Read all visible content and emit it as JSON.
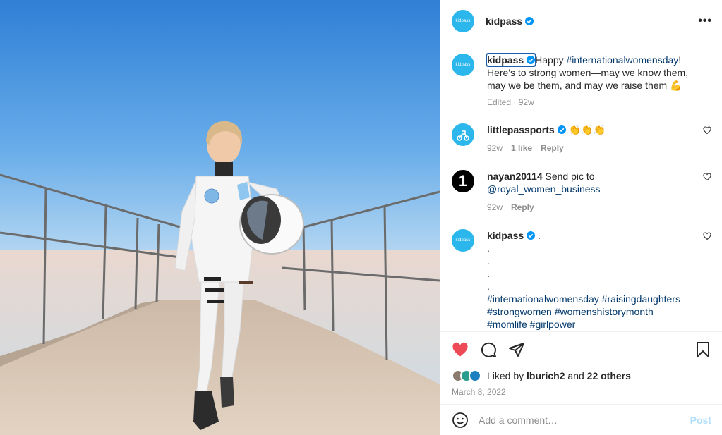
{
  "post": {
    "author": "kidpass",
    "avatar_text": "kidpass",
    "more_label": "•••"
  },
  "caption": {
    "username": "kidpass",
    "text_before": "Happy ",
    "hashtag": "#internationalwomensday",
    "text_after": "! Here's to strong women—may we know them, may we be them, and may we raise them",
    "emoji": "💪",
    "edited": "Edited",
    "time": "92w"
  },
  "comments": [
    {
      "username": "littlepassports",
      "text": "👏👏👏",
      "time": "92w",
      "likes": "1 like",
      "reply": "Reply"
    },
    {
      "username": "nayan20114",
      "text": "Send pic to",
      "mention": "@royal_women_business",
      "avatar_text": "1",
      "time": "92w",
      "reply": "Reply"
    },
    {
      "username": "kidpass",
      "avatar_text": "kidpass",
      "text": ".",
      "dots": [
        ".",
        ".",
        ".",
        "."
      ],
      "hashtags_line1": "#internationalwomensday #raisingdaughters",
      "hashtags_line2": "#strongwomen #womenshistorymonth",
      "hashtags_line3": "#momlife #girlpower"
    }
  ],
  "likes": {
    "prefix": "Liked by",
    "user": "lburich2",
    "joiner": "and",
    "others": "22 others"
  },
  "date": "March 8, 2022",
  "add_comment": {
    "placeholder": "Add a comment…",
    "post_label": "Post"
  },
  "colors": {
    "brand": "#2bb6ec",
    "verified": "#0095f6",
    "like_red": "#ed4956",
    "link": "#00376b"
  }
}
